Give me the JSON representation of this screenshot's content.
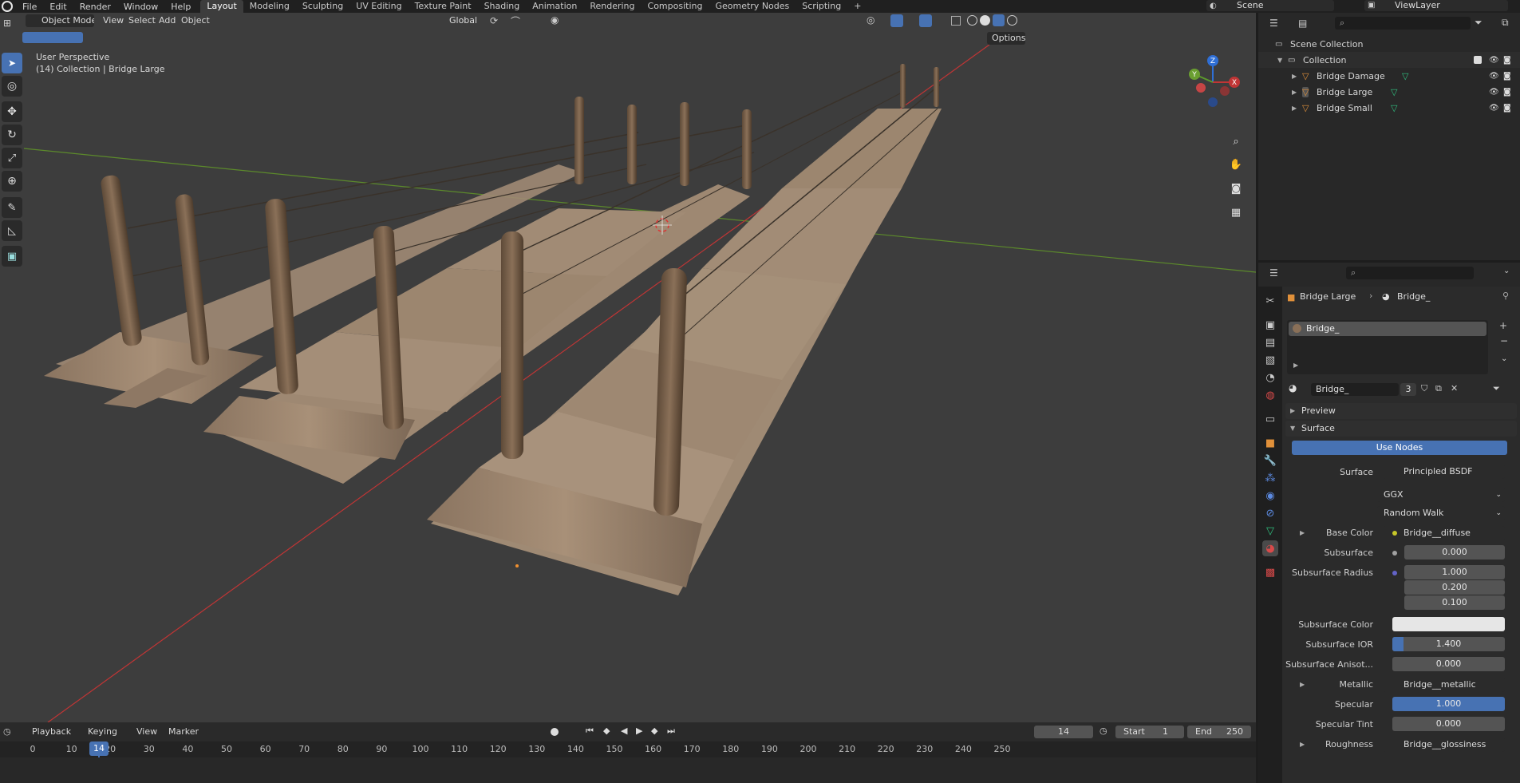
{
  "topbar": {
    "menus": [
      "File",
      "Edit",
      "Render",
      "Window",
      "Help"
    ],
    "workspaces": [
      "Layout",
      "Modeling",
      "Sculpting",
      "UV Editing",
      "Texture Paint",
      "Shading",
      "Animation",
      "Rendering",
      "Compositing",
      "Geometry Nodes",
      "Scripting"
    ],
    "active_workspace": "Layout",
    "add_tab": "+",
    "scene": "Scene",
    "view_layer": "ViewLayer"
  },
  "viewport": {
    "mode": "Object Mode",
    "menus": [
      "View",
      "Select",
      "Add",
      "Object"
    ],
    "orientation": "Global",
    "options": "Options",
    "info_line1": "User Perspective",
    "info_line2": "(14) Collection | Bridge Large",
    "gizmo": {
      "x": "X",
      "y": "Y",
      "z": "Z"
    }
  },
  "timeline": {
    "menus": [
      "Playback",
      "Keying",
      "View",
      "Marker"
    ],
    "current_frame": "14",
    "start_label": "Start",
    "start": "1",
    "end_label": "End",
    "end": "250",
    "ticks": [
      "0",
      "10",
      "14",
      "20",
      "30",
      "40",
      "50",
      "60",
      "70",
      "80",
      "90",
      "100",
      "110",
      "120",
      "130",
      "140",
      "150",
      "160",
      "170",
      "180",
      "190",
      "200",
      "210",
      "220",
      "230",
      "240",
      "250"
    ]
  },
  "outliner": {
    "scene_collection": "Scene Collection",
    "collection": "Collection",
    "items": [
      "Bridge Damage",
      "Bridge Large",
      "Bridge Small"
    ]
  },
  "properties": {
    "breadcrumb_object": "Bridge Large",
    "breadcrumb_material": "Bridge_",
    "slot": "Bridge_",
    "material_name": "Bridge_",
    "users": "3",
    "preview": "Preview",
    "surface_panel": "Surface",
    "use_nodes": "Use Nodes",
    "surface_label": "Surface",
    "surface_value": "Principled BSDF",
    "distribution": "GGX",
    "subsurface_method": "Random Walk",
    "rows": [
      {
        "label": "Base Color",
        "value": "Bridge__diffuse"
      },
      {
        "label": "Subsurface",
        "value": "0.000"
      },
      {
        "label": "Subsurface Radius",
        "value": "1.000"
      },
      {
        "label": "",
        "value": "0.200"
      },
      {
        "label": "",
        "value": "0.100"
      },
      {
        "label": "Subsurface Color",
        "value": ""
      },
      {
        "label": "Subsurface IOR",
        "value": "1.400"
      },
      {
        "label": "Subsurface Anisot...",
        "value": "0.000"
      },
      {
        "label": "Metallic",
        "value": "Bridge__metallic"
      },
      {
        "label": "Specular",
        "value": "1.000"
      },
      {
        "label": "Specular Tint",
        "value": "0.000"
      },
      {
        "label": "Roughness",
        "value": "Bridge__glossiness"
      }
    ]
  },
  "colors": {
    "accent": "#4772b3",
    "axis_x": "#c03535",
    "axis_y": "#5c8a2b",
    "playhead": "#4772b3"
  }
}
